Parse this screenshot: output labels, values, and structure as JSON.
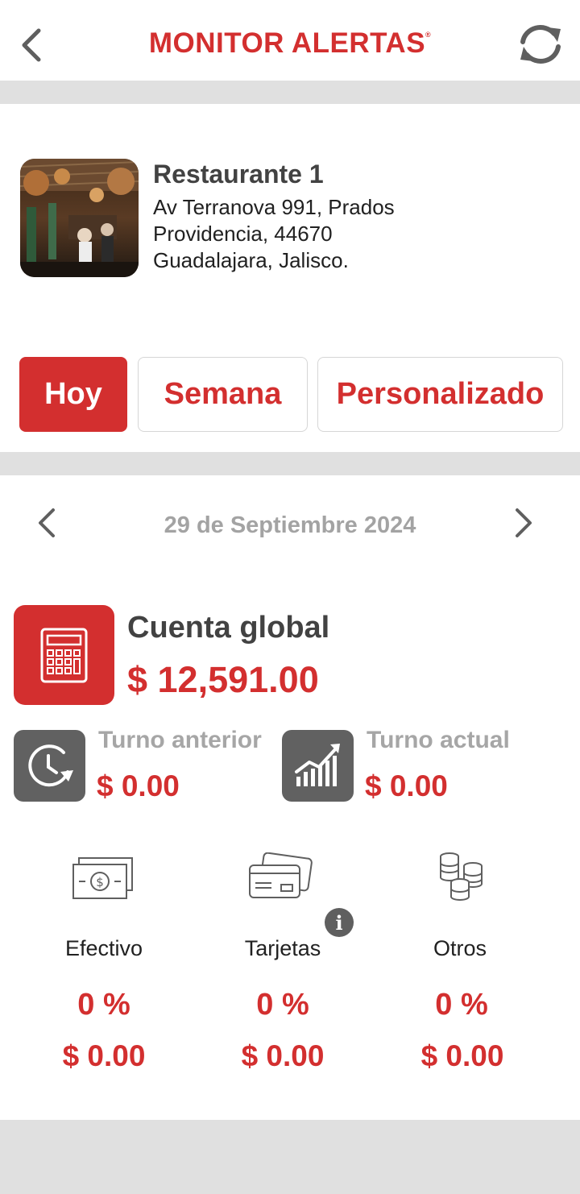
{
  "header": {
    "title": "MONITOR ALERTAS",
    "trademark": "®",
    "back_icon": "chevron-left-icon",
    "refresh_icon": "refresh-icon"
  },
  "restaurant": {
    "name": "Restaurante 1",
    "address_line1": "Av Terranova 991, Prados",
    "address_line2": "Providencia, 44670",
    "address_line3": "Guadalajara, Jalisco."
  },
  "tabs": [
    {
      "label": "Hoy",
      "active": true
    },
    {
      "label": "Semana",
      "active": false
    },
    {
      "label": "Personalizado",
      "active": false
    }
  ],
  "date_nav": {
    "label": "29 de Septiembre 2024",
    "prev_icon": "chevron-left-icon",
    "next_icon": "chevron-right-icon"
  },
  "global": {
    "title": "Cuenta global",
    "amount": "$ 12,591.00",
    "icon": "calculator-icon"
  },
  "shifts": [
    {
      "title": "Turno anterior",
      "amount": "$ 0.00",
      "icon": "clock-history-icon"
    },
    {
      "title": "Turno actual",
      "amount": "$ 0.00",
      "icon": "trending-chart-icon"
    }
  ],
  "payments": [
    {
      "label": "Efectivo",
      "percent": "0 %",
      "amount": "$ 0.00",
      "icon": "cash-icon"
    },
    {
      "label": "Tarjetas",
      "percent": "0 %",
      "amount": "$ 0.00",
      "icon": "cards-icon",
      "info_icon": "info-icon",
      "info_glyph": "i"
    },
    {
      "label": "Otros",
      "percent": "0 %",
      "amount": "$ 0.00",
      "icon": "coins-icon"
    }
  ],
  "colors": {
    "brand": "#d32f2f",
    "muted_text": "#a3a3a3",
    "dark_tile": "#616161",
    "band": "#e0e0e0"
  }
}
